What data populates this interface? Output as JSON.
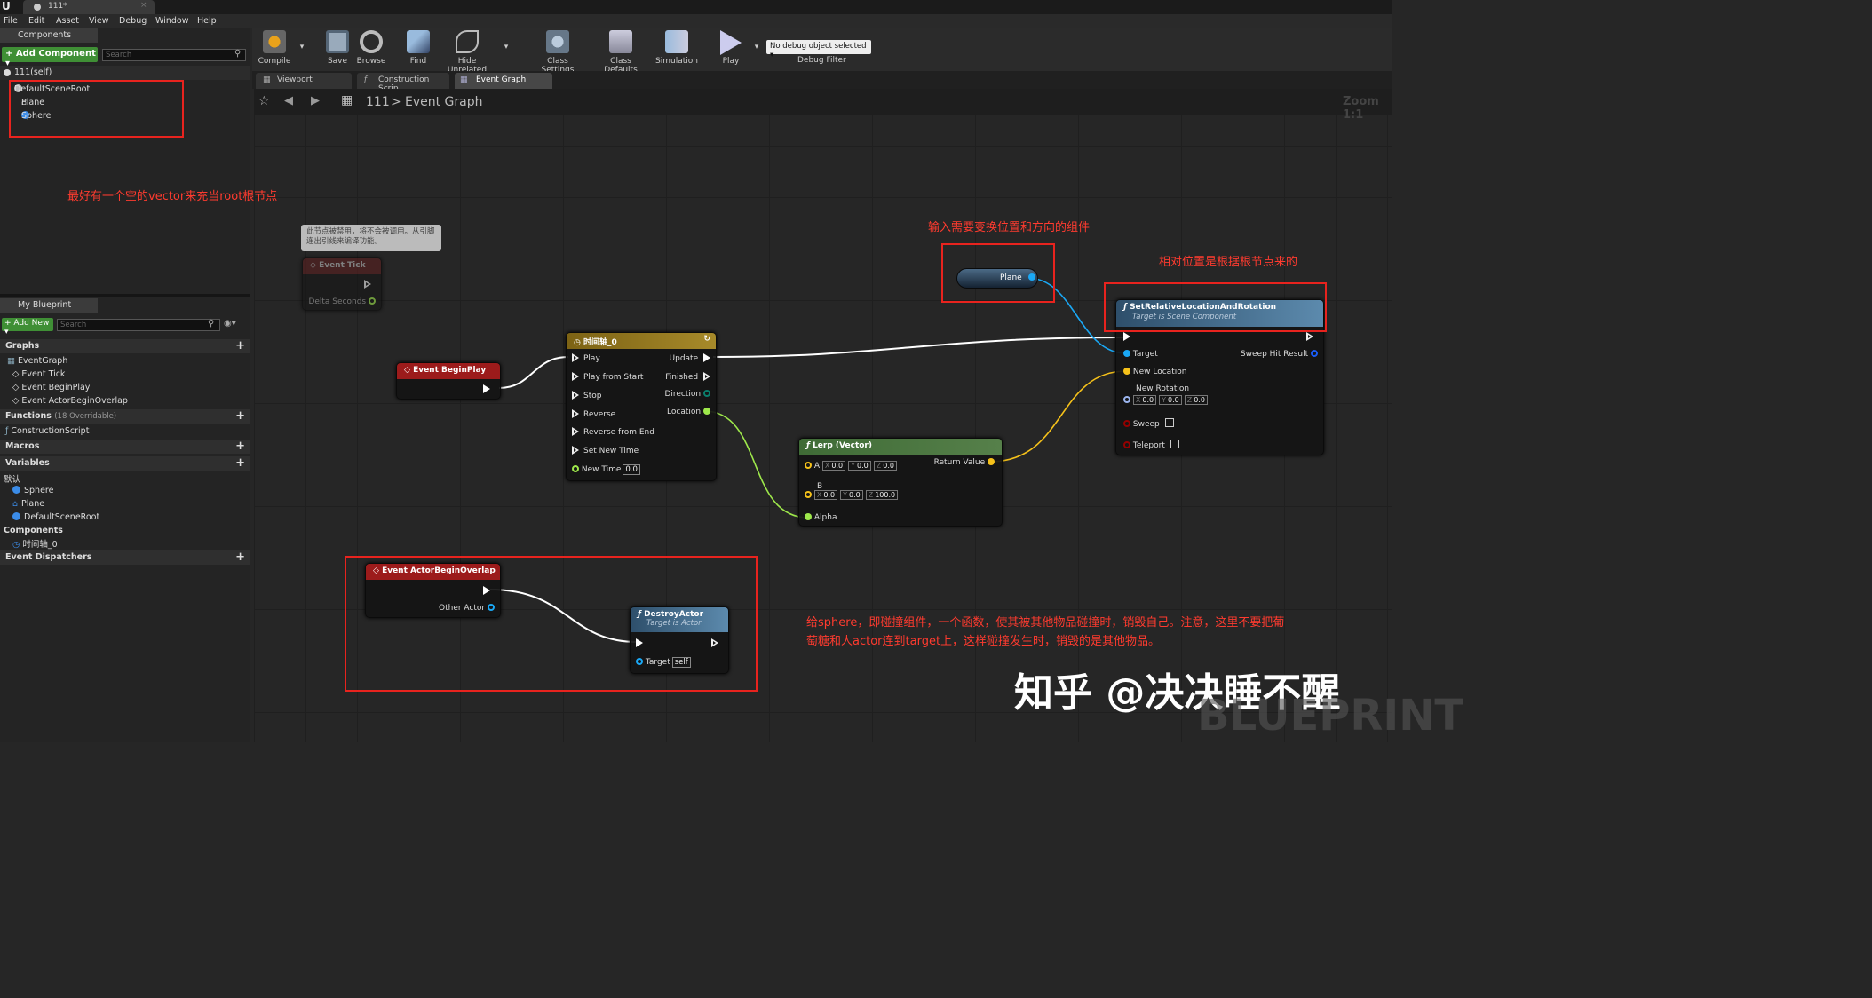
{
  "window": {
    "tab_title": "111*"
  },
  "menu": [
    "File",
    "Edit",
    "Asset",
    "View",
    "Debug",
    "Window",
    "Help"
  ],
  "components": {
    "title": "Components",
    "add_label": "+ Add Component ▾",
    "search_placeholder": "Search",
    "self_label": "111(self)",
    "tree": [
      "DefaultSceneRoot",
      "Plane",
      "Sphere"
    ]
  },
  "my_blueprint": {
    "title": "My Blueprint",
    "add_new": "+ Add New ▾",
    "search_placeholder": "Search",
    "graphs_label": "Graphs",
    "graphs": [
      "EventGraph",
      "Event Tick",
      "Event BeginPlay",
      "Event ActorBeginOverlap"
    ],
    "functions_label": "Functions",
    "functions_note": "(18 Overridable)",
    "functions": [
      "ConstructionScript"
    ],
    "macros_label": "Macros",
    "variables_label": "Variables",
    "var_group": "默认",
    "variables": [
      "Sphere",
      "Plane",
      "DefaultSceneRoot"
    ],
    "components_label": "Components",
    "component_vars": [
      "时间轴_0"
    ],
    "dispatchers_label": "Event Dispatchers"
  },
  "toolbar": {
    "compile": "Compile",
    "save": "Save",
    "browse": "Browse",
    "find": "Find",
    "hide_unrelated": "Hide Unrelated",
    "class_settings": "Class Settings",
    "class_defaults": "Class Defaults",
    "simulation": "Simulation",
    "play": "Play",
    "debug_select": "No debug object selected ▾",
    "debug_filter": "Debug Filter"
  },
  "graph_tabs": [
    "Viewport",
    "Construction Scrip",
    "Event Graph"
  ],
  "breadcrumb": {
    "root": "111",
    "sep": ">",
    "current": "Event Graph",
    "zoom": "Zoom 1:1"
  },
  "nodes": {
    "event_tick": {
      "comment": "此节点被禁用，将不会被调用。从引脚连出引线来编译功能。",
      "title": "Event Tick",
      "pin": "Delta Seconds"
    },
    "begin_play": {
      "title": "Event BeginPlay"
    },
    "timeline": {
      "title": "时间轴_0",
      "in": [
        "Play",
        "Play from Start",
        "Stop",
        "Reverse",
        "Reverse from End",
        "Set New Time"
      ],
      "new_time": "New Time",
      "new_time_val": "0.0",
      "out": [
        "Update",
        "Finished",
        "Direction",
        "Location"
      ]
    },
    "lerp": {
      "title": "Lerp (Vector)",
      "a": "A",
      "b": "B",
      "alpha": "Alpha",
      "ret": "Return Value",
      "a_vals": [
        "0.0",
        "0.0",
        "0.0"
      ],
      "b_vals": [
        "0.0",
        "0.0",
        "100.0"
      ],
      "axes": [
        "X",
        "Y",
        "Z"
      ]
    },
    "plane_var": {
      "label": "Plane"
    },
    "set_rel": {
      "title": "SetRelativeLocationAndRotation",
      "subtitle": "Target is Scene Component",
      "target": "Target",
      "new_location": "New Location",
      "new_rotation": "New Rotation",
      "rot_vals": [
        "0.0",
        "0.0",
        "0.0"
      ],
      "sweep": "Sweep",
      "teleport": "Teleport",
      "sweep_hit": "Sweep Hit Result"
    },
    "overlap": {
      "title": "Event ActorBeginOverlap",
      "other_actor": "Other Actor"
    },
    "destroy": {
      "title": "DestroyActor",
      "subtitle": "Target is Actor",
      "target": "Target",
      "self_val": "self"
    }
  },
  "annotations": {
    "a1": "最好有一个空的vector来充当root根节点",
    "a2": "输入需要变换位置和方向的组件",
    "a3": "相对位置是根据根节点来的",
    "a4_line1": "给sphere，即碰撞组件，一个函数，使其被其他物品碰撞时，销毁自己。注意，这里不要把葡",
    "a4_line2": "萄糖和人actor连到target上，这样碰撞发生时，销毁的是其他物品。"
  },
  "watermark": {
    "zhihu": "知乎 @决决睡不醒",
    "blueprint": "BLUEPRINT"
  },
  "colors": {
    "exec": "#ffffff",
    "object_pin": "#1aa8f5",
    "vector_pin": "#f5c11a",
    "float_pin": "#9ee84b",
    "bool_pin": "#930000",
    "annotation": "#ff3b2f",
    "event_header": "#9c1b1b",
    "timeline_header": "#7c6214",
    "lerp_header": "#3f6b36",
    "func_header": "#3c6a8a"
  }
}
